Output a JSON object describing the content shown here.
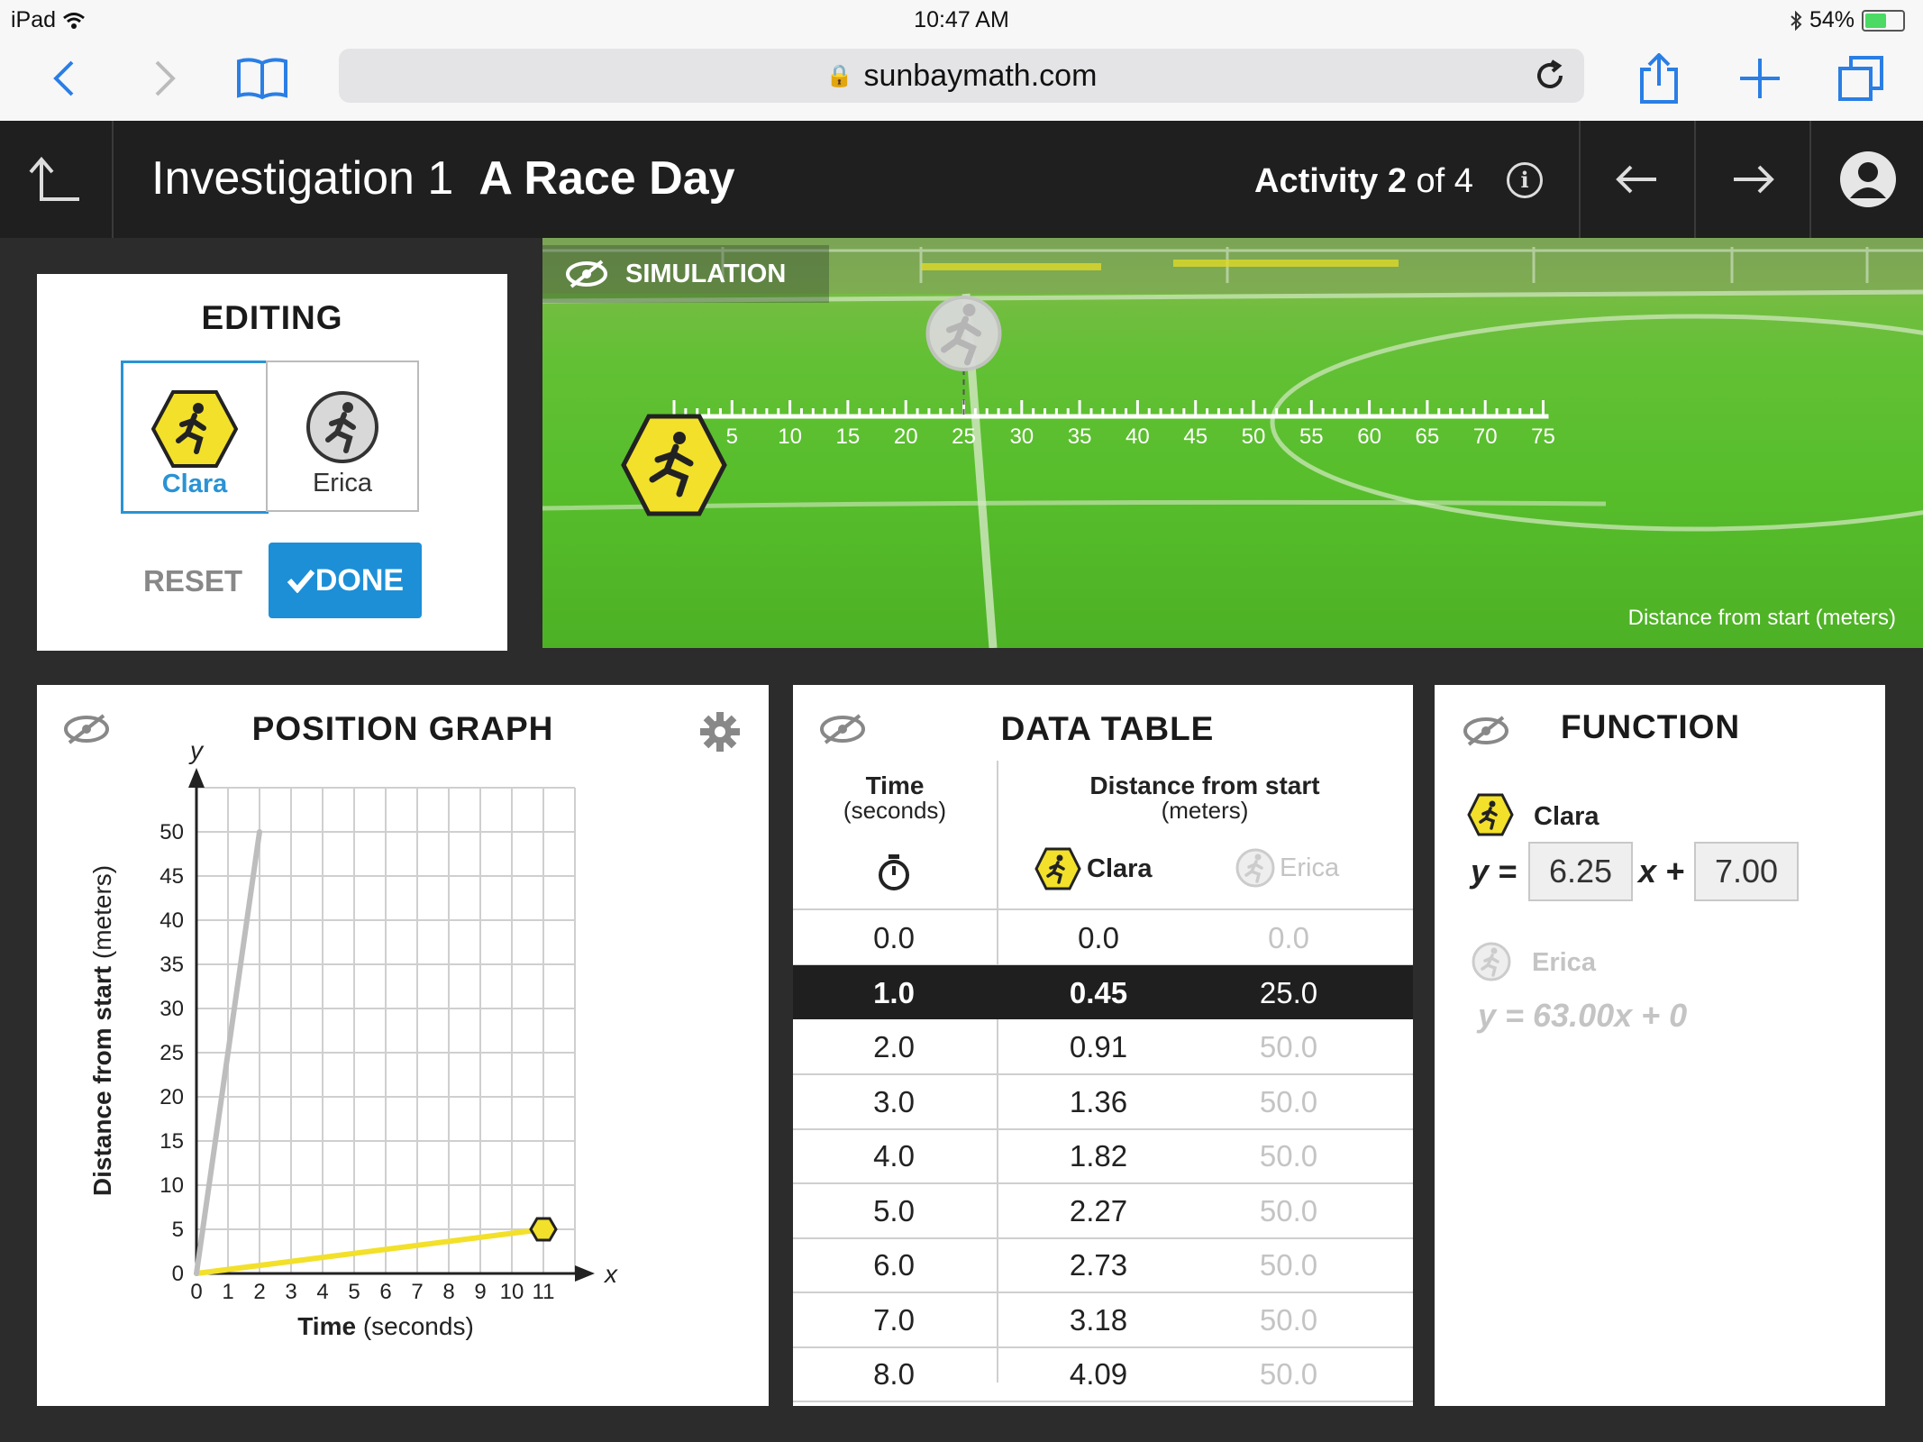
{
  "status_bar": {
    "device": "iPad",
    "time": "10:47 AM",
    "battery": "54%"
  },
  "browser": {
    "url": "sunbaymath.com"
  },
  "header": {
    "investigation": "Investigation 1",
    "title": "A Race Day",
    "activity_prefix": "Activity",
    "activity_num": "2",
    "activity_suffix": "of 4",
    "info_symbol": "i"
  },
  "editing": {
    "title": "EDITING",
    "runners": [
      {
        "name": "Clara",
        "selected": true
      },
      {
        "name": "Erica",
        "selected": false
      }
    ],
    "reset_label": "RESET",
    "done_label": "DONE"
  },
  "simulation": {
    "label": "SIMULATION",
    "ticks": [
      "0",
      "5",
      "10",
      "15",
      "20",
      "25",
      "30",
      "35",
      "40",
      "45",
      "50",
      "55",
      "60",
      "65",
      "70",
      "75"
    ],
    "axis_label": "Distance from start (meters)",
    "clara_position": 0,
    "erica_position": 25
  },
  "position_graph": {
    "title": "POSITION GRAPH",
    "y_var": "y",
    "x_var": "x",
    "ylabel_bold": "Distance from start",
    "ylabel_unit": "(meters)",
    "xlabel_bold": "Time",
    "xlabel_unit": "(seconds)",
    "x_ticks": [
      "0",
      "1",
      "2",
      "3",
      "4",
      "5",
      "6",
      "7",
      "8",
      "9",
      "10",
      "11"
    ],
    "y_ticks": [
      "0",
      "5",
      "10",
      "15",
      "20",
      "25",
      "30",
      "35",
      "40",
      "45",
      "50"
    ]
  },
  "chart_data": {
    "type": "line",
    "xlim": [
      0,
      12
    ],
    "ylim": [
      0,
      55
    ],
    "series": [
      {
        "name": "Clara",
        "color": "#f2e02a",
        "x": [
          0,
          11
        ],
        "y": [
          0,
          5
        ]
      },
      {
        "name": "Erica",
        "color": "#bdbdbd",
        "x": [
          0,
          2
        ],
        "y": [
          0,
          50
        ]
      }
    ]
  },
  "data_table": {
    "title": "DATA TABLE",
    "col_time": "Time",
    "col_time_unit": "(seconds)",
    "col_dist": "Distance from start",
    "col_dist_unit": "(meters)",
    "clara": "Clara",
    "erica": "Erica",
    "rows": [
      [
        "0.0",
        "0.0",
        "0.0"
      ],
      [
        "1.0",
        "0.45",
        "25.0"
      ],
      [
        "2.0",
        "0.91",
        "50.0"
      ],
      [
        "3.0",
        "1.36",
        "50.0"
      ],
      [
        "4.0",
        "1.82",
        "50.0"
      ],
      [
        "5.0",
        "2.27",
        "50.0"
      ],
      [
        "6.0",
        "2.73",
        "50.0"
      ],
      [
        "7.0",
        "3.18",
        "50.0"
      ],
      [
        "8.0",
        "4.09",
        "50.0"
      ]
    ],
    "selected_row": 1
  },
  "function": {
    "title": "FUNCTION",
    "clara_name": "Clara",
    "y_eq": "y =",
    "slope": "6.25",
    "x_plus": "x +",
    "intercept": "7.00",
    "erica_name": "Erica",
    "erica_eq": "y = 63.00x + 0"
  },
  "colors": {
    "accent_blue": "#1d8fd6",
    "clara_yellow": "#f2e02a",
    "erica_gray": "#bdbdbd"
  }
}
